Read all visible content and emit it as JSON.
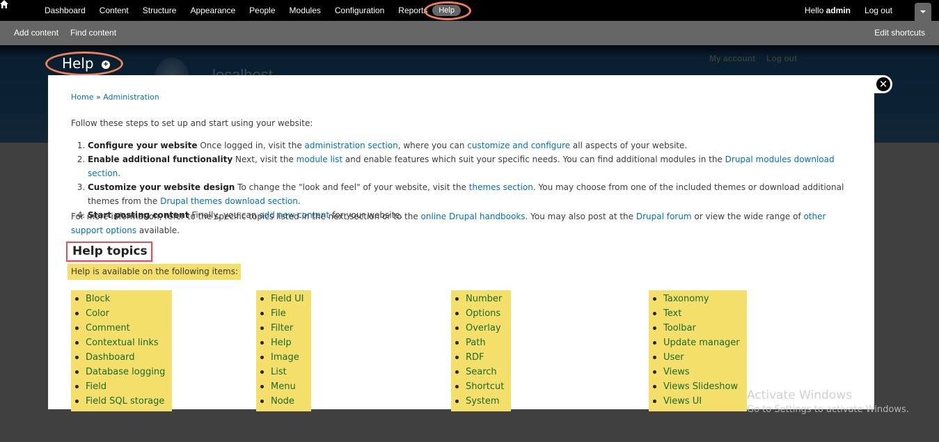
{
  "toolbar": {
    "home_icon": "home-icon",
    "menu": [
      {
        "label": "Dashboard"
      },
      {
        "label": "Content"
      },
      {
        "label": "Structure"
      },
      {
        "label": "Appearance"
      },
      {
        "label": "People"
      },
      {
        "label": "Modules"
      },
      {
        "label": "Configuration"
      },
      {
        "label": "Reports"
      },
      {
        "label": "Help",
        "active": true
      }
    ],
    "greeting": "Hello",
    "username": "admin",
    "logout": "Log out",
    "toggle_icon": "triangle-down-icon"
  },
  "shortcuts": {
    "items": [
      {
        "label": "Add content"
      },
      {
        "label": "Find content"
      }
    ],
    "edit": "Edit shortcuts"
  },
  "header": {
    "title": "Help",
    "add_shortcut_icon": "plus-circle-icon",
    "site_name": "localhost",
    "account_links": [
      {
        "label": "My account"
      },
      {
        "label": "Log out"
      }
    ]
  },
  "overlay": {
    "close_icon": "close-icon",
    "breadcrumb": {
      "home": "Home",
      "sep": " » ",
      "admin": "Administration"
    },
    "intro": "Follow these steps to set up and start using your website:",
    "steps": [
      {
        "title": "Configure your website",
        "t1": " Once logged in, visit the ",
        "l1": "administration section",
        "t2": ", where you can ",
        "l2": "customize and configure",
        "t3": " all aspects of your website."
      },
      {
        "title": "Enable additional functionality",
        "t1": " Next, visit the ",
        "l1": "module list",
        "t2": " and enable features which suit your specific needs. You can find additional modules in the ",
        "l2": "Drupal modules download section",
        "t3": "."
      },
      {
        "title": "Customize your website design",
        "t1": " To change the \"look and feel\" of your website, visit the ",
        "l1": "themes section",
        "t2": ". You may choose from one of the included themes or download additional themes from the ",
        "l2": "Drupal themes download section",
        "t3": "."
      },
      {
        "title": "Start posting content",
        "t1": " Finally, you can ",
        "l1": "add new content",
        "t2": " for your website."
      }
    ],
    "more": {
      "t1": "For more information, refer to the specific topics listed in the next section or to the ",
      "l1": "online Drupal handbooks",
      "t2": ". You may also post at the ",
      "l2": "Drupal forum",
      "t3": " or view the wide range of ",
      "l3": "other support options",
      "t4": " available."
    },
    "topics_title": "Help topics",
    "available": "Help is available on the following items:",
    "columns": [
      [
        "Block",
        "Color",
        "Comment",
        "Contextual links",
        "Dashboard",
        "Database logging",
        "Field",
        "Field SQL storage"
      ],
      [
        "Field UI",
        "File",
        "Filter",
        "Help",
        "Image",
        "List",
        "Menu",
        "Node"
      ],
      [
        "Number",
        "Options",
        "Overlay",
        "Path",
        "RDF",
        "Search",
        "Shortcut",
        "System"
      ],
      [
        "Taxonomy",
        "Text",
        "Toolbar",
        "Update manager",
        "User",
        "Views",
        "Views Slideshow",
        "Views UI"
      ]
    ]
  },
  "watermark": {
    "line1": "Activate Windows",
    "line2": "Go to Settings to activate Windows."
  },
  "colors": {
    "link": "#0071b3",
    "highlight": "#f4df6a",
    "annotation_ring": "#ef7f5a",
    "annotation_box": "#e0505a"
  }
}
